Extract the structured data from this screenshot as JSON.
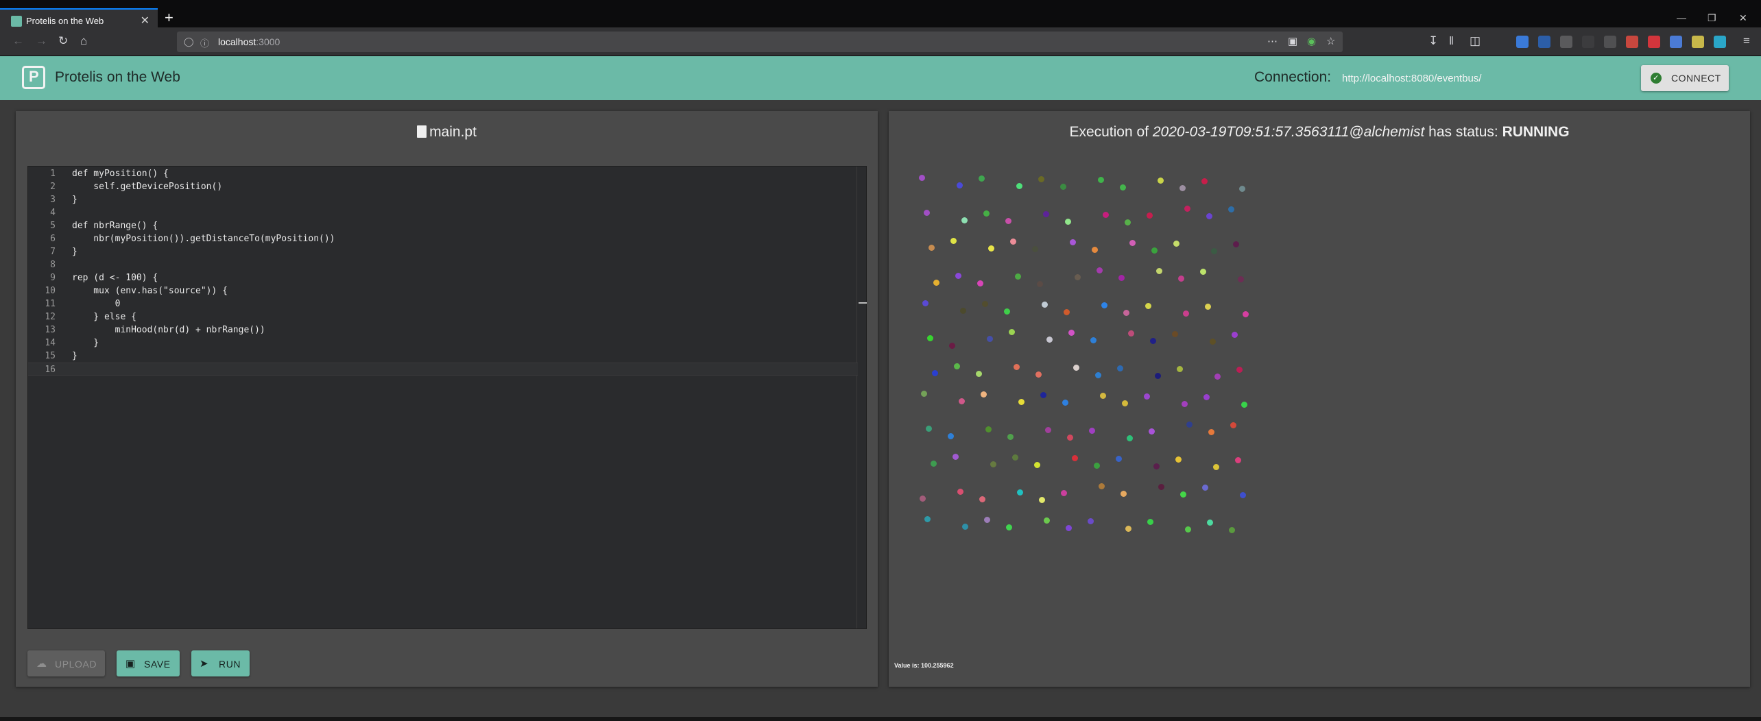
{
  "browser": {
    "tab_title": "Protelis on the Web",
    "tab_close": "✕",
    "new_tab": "+",
    "url_host": "localhost",
    "url_port": ":3000"
  },
  "app": {
    "title": "Protelis on the Web",
    "connection_label": "Connection:",
    "connection_url": "http://localhost:8080/eventbus/",
    "connect_button": "CONNECT",
    "accent_color": "#6bbaa7"
  },
  "editor": {
    "filename": "main.pt",
    "lines": [
      {
        "n": "1",
        "code": "def myPosition() {"
      },
      {
        "n": "2",
        "code": "    self.getDevicePosition()"
      },
      {
        "n": "3",
        "code": "}"
      },
      {
        "n": "4",
        "code": ""
      },
      {
        "n": "5",
        "code": "def nbrRange() {"
      },
      {
        "n": "6",
        "code": "    nbr(myPosition()).getDistanceTo(myPosition())"
      },
      {
        "n": "7",
        "code": "}"
      },
      {
        "n": "8",
        "code": ""
      },
      {
        "n": "9",
        "code": "rep (d <- 100) {"
      },
      {
        "n": "10",
        "code": "    mux (env.has(\"source\")) {"
      },
      {
        "n": "11",
        "code": "        0"
      },
      {
        "n": "12",
        "code": "    } else {"
      },
      {
        "n": "13",
        "code": "        minHood(nbr(d) + nbrRange())"
      },
      {
        "n": "14",
        "code": "    }"
      },
      {
        "n": "15",
        "code": "}"
      },
      {
        "n": "16",
        "code": ""
      }
    ],
    "buttons": {
      "upload": "UPLOAD",
      "save": "SAVE",
      "run": "RUN"
    }
  },
  "execution": {
    "prefix": "Execution of ",
    "id": "2020-03-19T09:51:57.3563111@alchemist",
    "middle": " has status: ",
    "status": "RUNNING",
    "value_text": "Value is: 100.255962"
  },
  "dots": [
    "#a24fc7",
    "#4a4ad8",
    "#3fa64f",
    "#4ee07a",
    "#6a6a25",
    "#3b8b42",
    "#3fb44a",
    "#44b44c",
    "#c9d449",
    "#9d8fa2",
    "#c71e4a",
    "#6f8a8e",
    "#a14fc4",
    "#8ee0b2",
    "#46b045",
    "#c84fa9",
    "#5d2399",
    "#91e78b",
    "#c61e7d",
    "#57b049",
    "#c61e4e",
    "#c4205e",
    "#6a44d1",
    "#2e6ea8",
    "#c78c50",
    "#e0e446",
    "#e8e449",
    "#ec8d98",
    "#4a4f3e",
    "#a957d8",
    "#e68a3e",
    "#d25fb6",
    "#3aa33d",
    "#c6dd6a",
    "#3b5b44",
    "#5d1d4c",
    "#e6b030",
    "#8a48d9",
    "#d845b8",
    "#4daa44",
    "#5a4b45",
    "#685c50",
    "#a43bad",
    "#a225a5",
    "#c3d56c",
    "#c33f8d",
    "#bde36b",
    "#6d2d54",
    "#5a4ad4",
    "#4c4a2d",
    "#524d2e",
    "#3fcf4a",
    "#c0cbd4",
    "#d05b2c",
    "#2e84e8",
    "#c7659a",
    "#d5d64a",
    "#c93f8d",
    "#dcd051",
    "#d63fa1",
    "#38d430",
    "#6a1c45",
    "#454fa9",
    "#9cd452",
    "#c7c6d0",
    "#d253c6",
    "#2e80d8",
    "#bd4c79",
    "#202088",
    "#6a4b27",
    "#5e5026",
    "#9b3fcf",
    "#2a3fd0",
    "#5bb84a",
    "#a6d86c",
    "#e07058",
    "#e17060",
    "#dbd0cd",
    "#2e7fd0",
    "#2e6ab1",
    "#1c1c7a",
    "#a5b640",
    "#a23fb5",
    "#bc1e55",
    "#74a258",
    "#d0588a",
    "#f0b480",
    "#e7dd38",
    "#1e2599",
    "#2e80e0",
    "#d4b840",
    "#d5ba3b",
    "#9c47cf",
    "#a23fbd",
    "#983fce",
    "#38d44a",
    "#3a9f78",
    "#2e80d8",
    "#50902e",
    "#50a04c",
    "#a03f9b",
    "#d0485e",
    "#a03fc2",
    "#2ec078",
    "#a953d9",
    "#2f3f8d",
    "#e6793b",
    "#d4493a",
    "#3e9c50",
    "#a15ad2",
    "#667a40",
    "#5d7a3e",
    "#d4e431",
    "#d9303a",
    "#3ba03f",
    "#3863c8",
    "#5a1f4c",
    "#e6c235",
    "#dcc438",
    "#db3f7d",
    "#a25c7a",
    "#d84f70",
    "#db6878",
    "#20c0c0",
    "#e2e86a",
    "#cb3f9e",
    "#ac7a3a",
    "#e6a960",
    "#5a1e3f",
    "#44d648",
    "#6a6ad0",
    "#3e4fce",
    "#2e9aa8",
    "#2e90a8",
    "#9c7db8",
    "#40d44f",
    "#6cc94e",
    "#7e46d6",
    "#6a4bc7",
    "#dbb858",
    "#38d049",
    "#56c84b",
    "#4ddaa0",
    "#5a9a3e"
  ]
}
